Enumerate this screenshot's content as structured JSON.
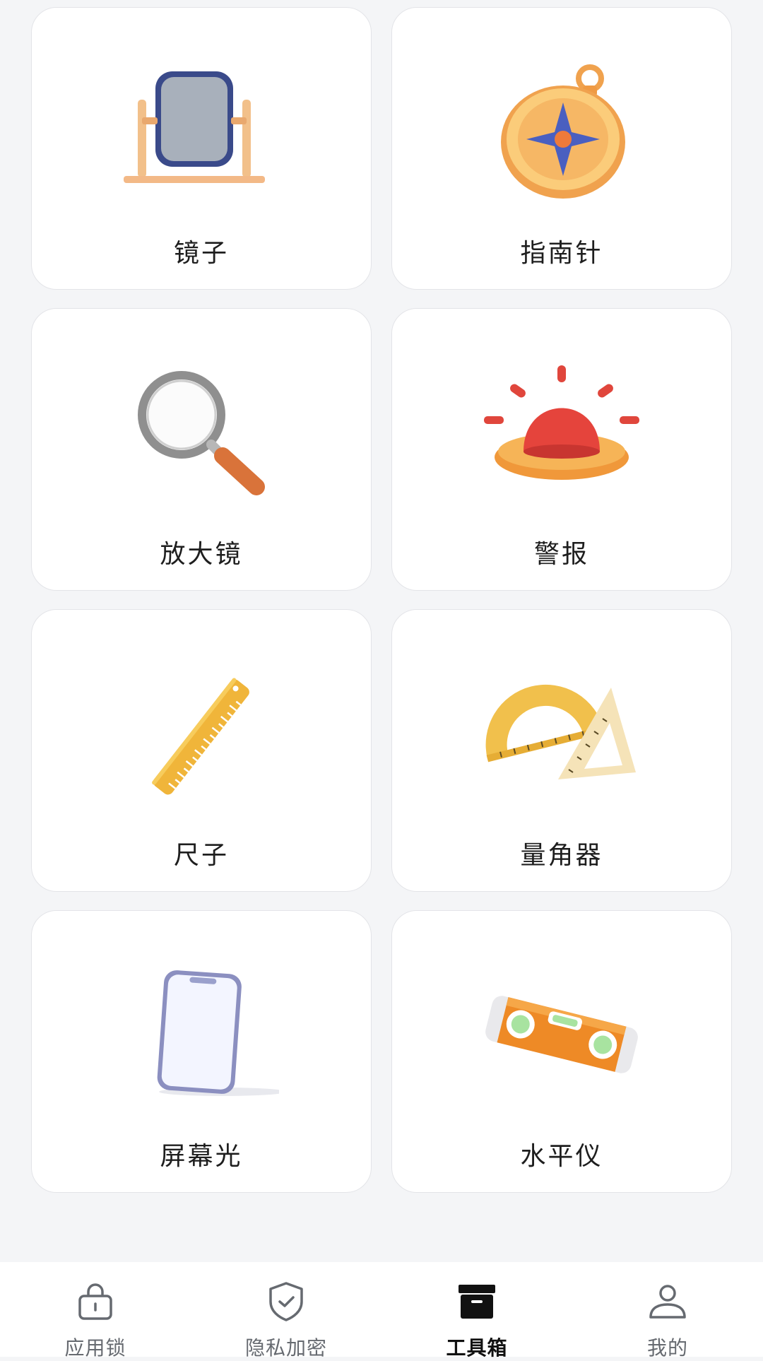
{
  "tools": [
    {
      "label": "镜子",
      "icon": "mirror-icon"
    },
    {
      "label": "指南针",
      "icon": "compass-icon"
    },
    {
      "label": "放大镜",
      "icon": "magnifier-icon"
    },
    {
      "label": "警报",
      "icon": "alarm-icon"
    },
    {
      "label": "尺子",
      "icon": "ruler-icon"
    },
    {
      "label": "量角器",
      "icon": "protractor-icon"
    },
    {
      "label": "屏幕光",
      "icon": "screen-light-icon"
    },
    {
      "label": "水平仪",
      "icon": "spirit-level-icon"
    }
  ],
  "tabbar": {
    "active_index": 2,
    "active_color": "#111111",
    "inactive_color": "#666a70",
    "items": [
      {
        "label": "应用锁",
        "icon": "lock-icon"
      },
      {
        "label": "隐私加密",
        "icon": "shield-icon"
      },
      {
        "label": "工具箱",
        "icon": "toolbox-icon"
      },
      {
        "label": "我的",
        "icon": "user-icon"
      }
    ]
  }
}
